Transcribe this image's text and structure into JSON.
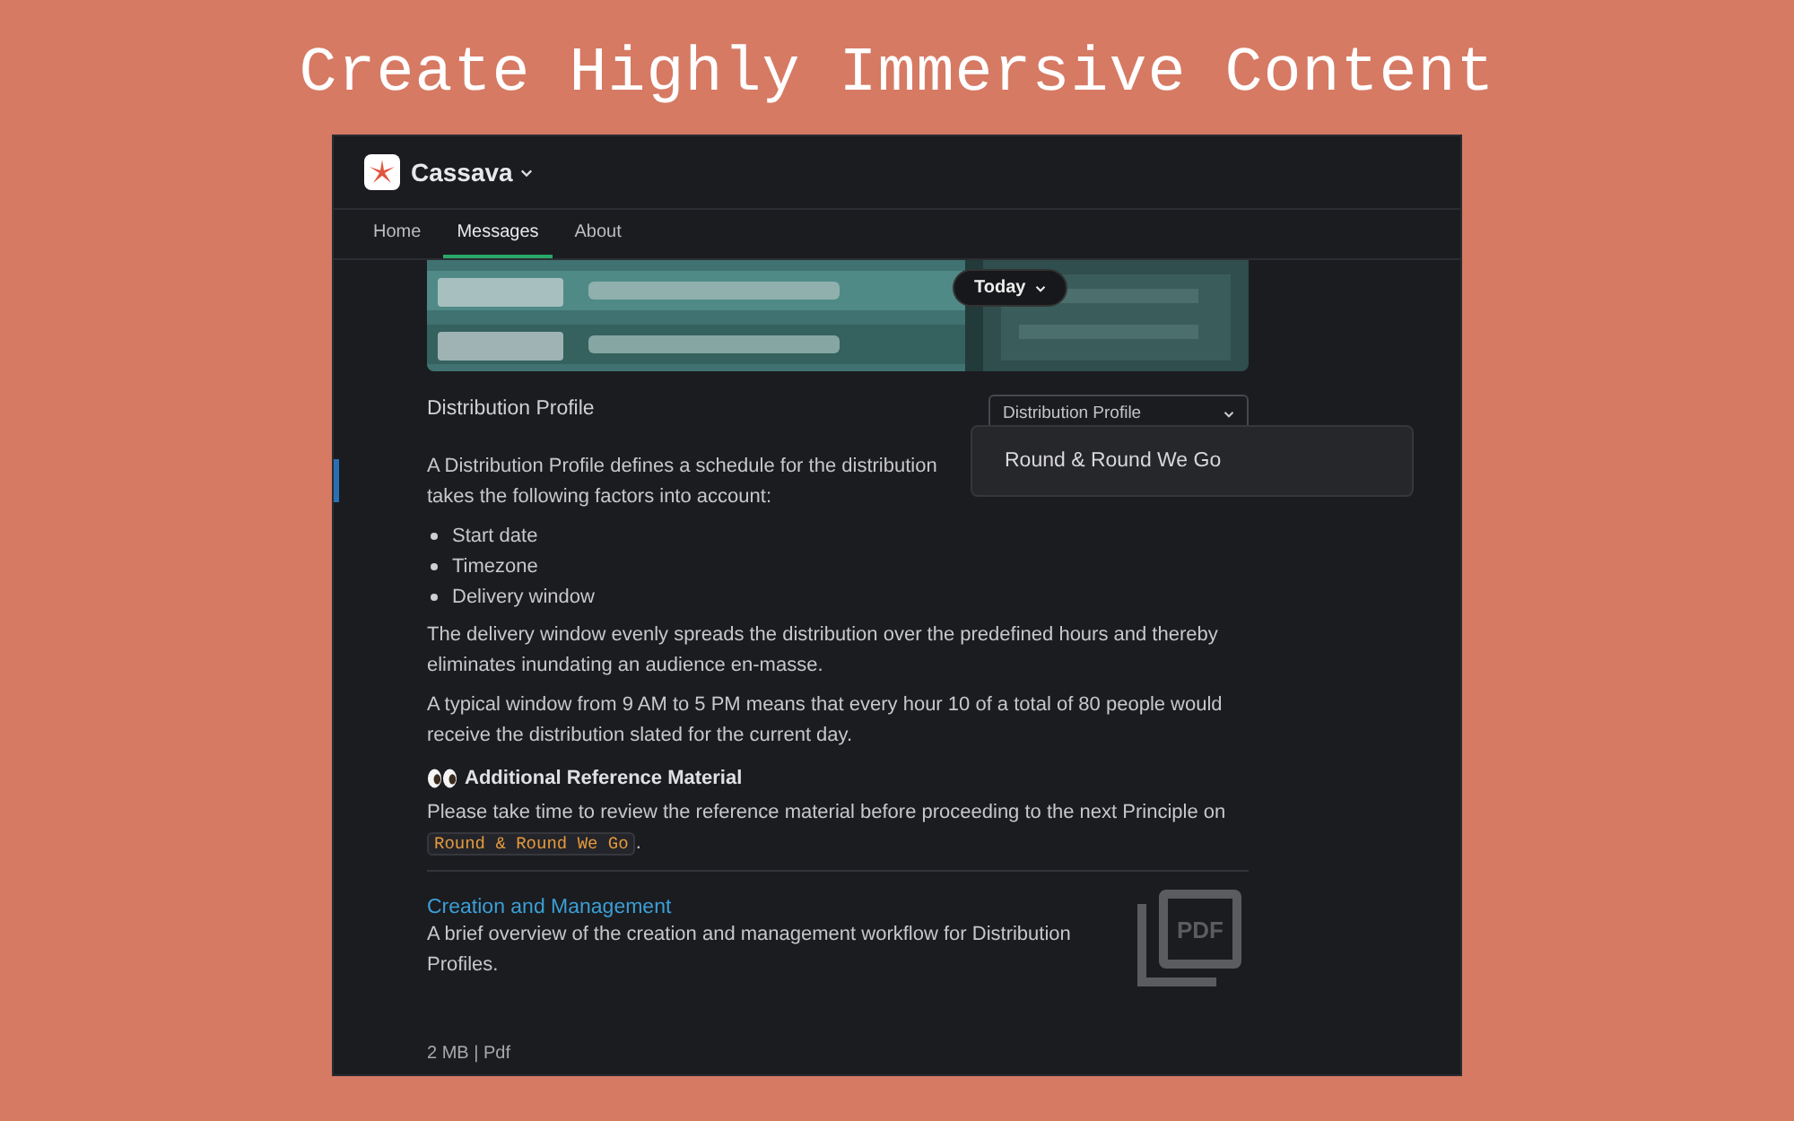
{
  "headline": "Create Highly Immersive Content",
  "app": {
    "name": "Cassava"
  },
  "tabs": [
    {
      "label": "Home",
      "selected": false
    },
    {
      "label": "Messages",
      "selected": true
    },
    {
      "label": "About",
      "selected": false
    }
  ],
  "banner": {
    "date_button": "Today"
  },
  "profile": {
    "label": "Distribution Profile",
    "select_value": "Distribution Profile",
    "menu_open": true,
    "menu_items": [
      "Round & Round We Go"
    ]
  },
  "intro_lines": [
    "A Distribution Profile defines a schedule for the distribution",
    "takes the following factors into account:"
  ],
  "factors": [
    "Start date",
    "Timezone",
    "Delivery window"
  ],
  "paragraphs": [
    "The delivery window evenly spreads the distribution over the predefined hours and thereby eliminates inundating an audience en-masse.",
    "A typical window from 9 AM to 5 PM means that every hour 10 of a total of 80 people would receive the distribution slated for the current day."
  ],
  "reference": {
    "heading": "Additional Reference Material",
    "text": "Please take time to review the reference material before proceeding to the next Principle on",
    "code": "Round & Round We Go",
    "after": "."
  },
  "attachment": {
    "title": "Creation and Management",
    "description": "A brief overview of the creation and management workflow for Distribution Profiles.",
    "icon_label": "PDF",
    "meta": "2 MB | Pdf"
  }
}
